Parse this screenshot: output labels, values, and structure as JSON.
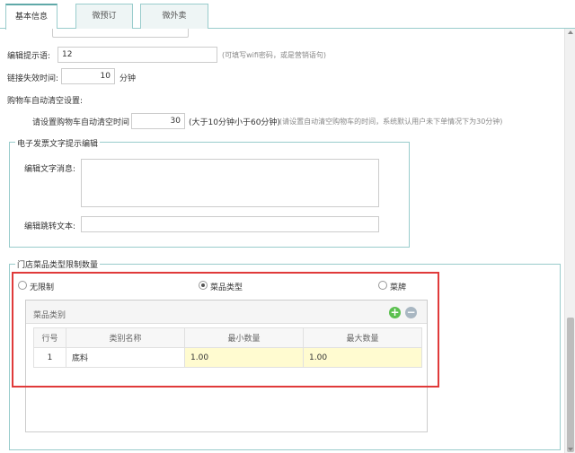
{
  "tabs": [
    {
      "label": "基本信息",
      "active": true
    },
    {
      "label": "微预订",
      "active": false
    },
    {
      "label": "微外卖",
      "active": false
    }
  ],
  "form": {
    "prompt_label": "编辑提示语:",
    "prompt_value": "12",
    "prompt_hint": "(可填写wifi密码，或是营销语句)",
    "link_expire_label": "链接失效时间:",
    "link_expire_value": "10",
    "link_expire_unit": "分钟",
    "cart_clear_title": "购物车自动清空设置:",
    "cart_clear_label": "请设置购物车自动清空时间",
    "cart_clear_value": "30",
    "cart_clear_range": "(大于10分钟小于60分钟)",
    "cart_clear_hint": "(请设置自动清空购物车的时间，系统默认用户未下单情况下为30分钟)"
  },
  "invoice": {
    "legend": "电子发票文字提示编辑",
    "message_label": "编辑文字消息:",
    "message_value": "",
    "jump_label": "编辑跳转文本:",
    "jump_value": ""
  },
  "limit": {
    "legend": "门店菜品类型限制数量",
    "options": [
      {
        "label": "无限制",
        "checked": false
      },
      {
        "label": "菜品类型",
        "checked": true
      },
      {
        "label": "菜牌",
        "checked": false
      }
    ],
    "grid_title": "菜品类别",
    "icons": {
      "add": "plus-circle-icon",
      "remove": "minus-circle-icon"
    },
    "colors": {
      "add": "#5bc04f",
      "remove": "#a9b7c2",
      "highlight": "#e03a3a"
    },
    "columns": [
      "行号",
      "类别名称",
      "最小数量",
      "最大数量"
    ],
    "rows": [
      {
        "no": "1",
        "name": "底料",
        "min": "1.00",
        "max": "1.00"
      }
    ]
  }
}
